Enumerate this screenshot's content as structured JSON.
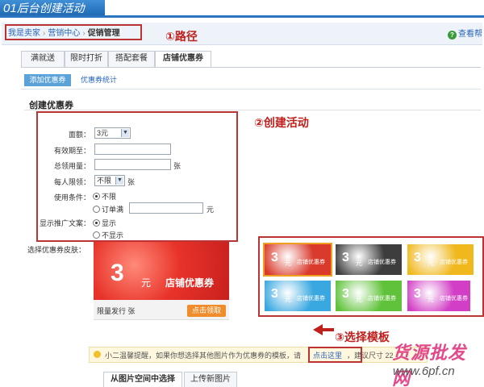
{
  "banner": {
    "number": "01",
    "title": "后台创建活动"
  },
  "breadcrumb": [
    "我是卖家",
    "营销中心",
    "促销管理"
  ],
  "help": "查看帮",
  "annotations": {
    "path": "①路径",
    "create": "②创建活动",
    "template": "③选择模板"
  },
  "tabs": [
    "满就送",
    "限时打折",
    "搭配套餐",
    "店铺优惠券"
  ],
  "subtabs": {
    "add": "添加优惠券",
    "stats": "优惠券统计"
  },
  "section_title": "创建优惠券",
  "form": {
    "amount_label": "面额：",
    "amount_value": "3元",
    "expiry_label": "有效期至：",
    "total_label": "总领用量：",
    "total_unit": "张",
    "per_person_label": "每人限领：",
    "per_person_value": "不限",
    "per_person_unit": "张",
    "condition_label": "使用条件：",
    "condition_opt1": "不限",
    "condition_opt2": "订单满",
    "condition_unit": "元",
    "promo_label": "显示推广文案：",
    "promo_opt1": "显示",
    "promo_opt2": "不显示"
  },
  "skin": {
    "label": "选择优惠券皮肤：",
    "preview_number": "3",
    "preview_unit": "元",
    "preview_caption": "店铺优惠券",
    "limit_text": "限量发行 张",
    "claim_button": "点击领取",
    "thumb_number": "3",
    "thumb_unit": "元",
    "thumb_caption": "店铺优惠券",
    "colors": [
      "#d93a2c",
      "#3d3d3d",
      "#f0b81c",
      "#3aa8e0",
      "#5fc23a",
      "#d23fc6"
    ]
  },
  "tip": {
    "text": "小二温馨提醒，如果你想选择其他图片作为优惠券的模板，请",
    "link": "点击这里",
    "suffix": "，建议尺寸 22"
  },
  "bottom_tabs": [
    "从图片空间中选择",
    "上传新图片"
  ],
  "watermark": {
    "line1": "货源批发网",
    "line2": "www.6pf.cn"
  }
}
